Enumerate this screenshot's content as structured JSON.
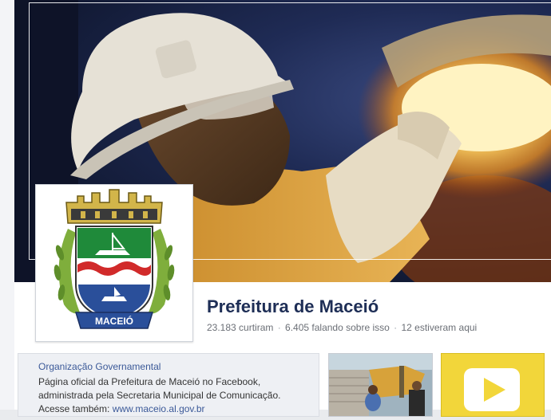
{
  "page": {
    "name": "Prefeitura de Maceió",
    "stats": {
      "likes": "23.183 curtiram",
      "talking": "6.405 falando sobre isso",
      "checkins": "12 estiveram aqui"
    }
  },
  "about": {
    "category": "Organização Governamental",
    "line1": "Página oficial da Prefeitura de Maceió no Facebook,",
    "line2": "administrada pela Secretaria Municipal de Comunicação.",
    "line3_prefix": "Acesse também:",
    "line3_link": "www.maceio.al.gov.br"
  },
  "profile": {
    "crest_text": "MACEIÓ"
  },
  "colors": {
    "title": "#1e2e56",
    "link": "#3b5998",
    "video_tile": "#f2d63a"
  },
  "icons": {
    "video": "play-icon"
  }
}
